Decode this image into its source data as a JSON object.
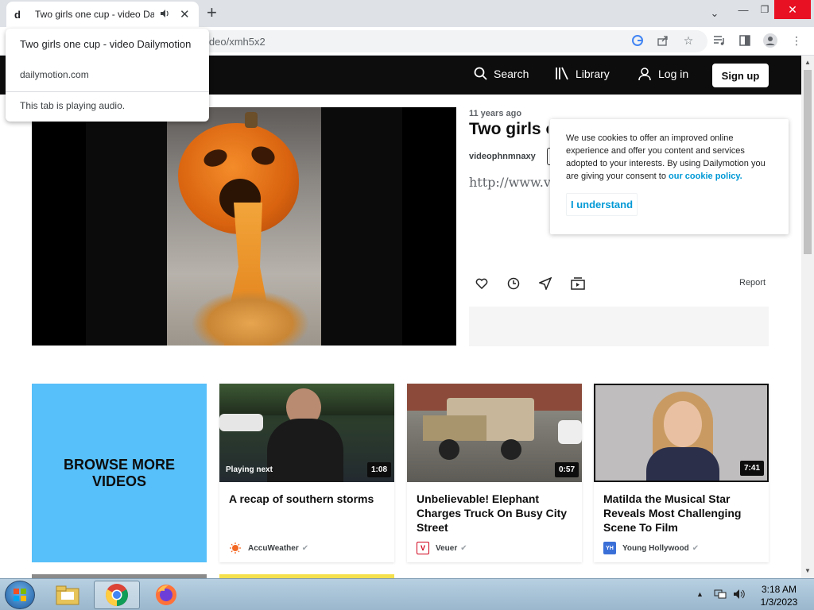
{
  "browser": {
    "tab_title": "Two girls one cup - video Da",
    "tab_favicon": "d",
    "url": "ideo/xmh5x2",
    "hover_card": {
      "title": "Two girls one cup - video Dailymotion",
      "domain": "dailymotion.com",
      "audio_note": "This tab is playing audio."
    }
  },
  "header": {
    "search_label": "Search",
    "library_label": "Library",
    "login_label": "Log in",
    "signup_label": "Sign up"
  },
  "video": {
    "ago": "11 years ago",
    "title": "Two girls o",
    "owner": "videophnmnaxy",
    "description": "http://www.vid",
    "report_label": "Report"
  },
  "cookie": {
    "text": "We use cookies to offer an improved online experience and offer you content and services adopted to your interests. By using Dailymotion you are giving your consent to ",
    "link": "our cookie policy.",
    "button": "I understand"
  },
  "grid": {
    "browse_label": "BROWSE MORE VIDEOS",
    "cards": [
      {
        "title": "A recap of southern storms",
        "channel": "AccuWeather",
        "duration": "1:08",
        "badge": "Playing next"
      },
      {
        "title": "Unbelievable! Elephant Charges Truck On Busy City Street",
        "channel": "Veuer",
        "duration": "0:57"
      },
      {
        "title": "Matilda the Musical Star Reveals Most Challenging Scene To Film",
        "channel": "Young Hollywood",
        "duration": "7:41"
      }
    ]
  },
  "taskbar": {
    "time": "3:18 AM",
    "date": "1/3/2023"
  },
  "colors": {
    "accent": "#0099d6",
    "browse_bg": "#57bff9",
    "header_bg": "#0d0d0d"
  }
}
